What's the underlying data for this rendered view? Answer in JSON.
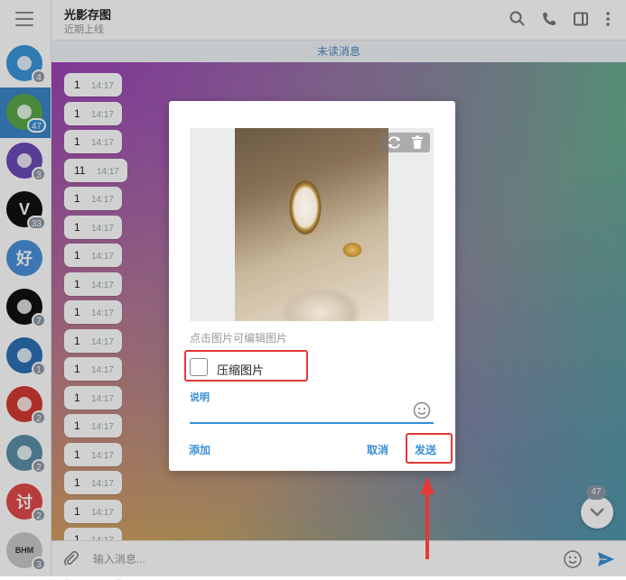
{
  "sidebar": {
    "chats": [
      {
        "label": "",
        "badge": "4",
        "color": "#3a95d8",
        "icon": "paper-plane-icon"
      },
      {
        "label": "",
        "badge": "47",
        "color": "#5ba84a",
        "icon": "sprout-icon"
      },
      {
        "label": "",
        "badge": "3",
        "color": "#6c4bb8",
        "icon": "rocket-icon"
      },
      {
        "label": "V",
        "badge": "33",
        "color": "#111111",
        "icon": "v-logo-icon"
      },
      {
        "label": "好",
        "badge": "",
        "color": "#4a90d9",
        "icon": ""
      },
      {
        "label": "",
        "badge": "7",
        "color": "#111111",
        "icon": "apple-icon"
      },
      {
        "label": "",
        "badge": "1",
        "color": "#2d6fb4",
        "icon": "head-icon"
      },
      {
        "label": "",
        "badge": "2",
        "color": "#d33a32",
        "icon": "globe-icon"
      },
      {
        "label": "",
        "badge": "2",
        "color": "#5b8fa6",
        "icon": "lock-icon"
      },
      {
        "label": "讨",
        "badge": "2",
        "color": "#e04a48",
        "icon": ""
      },
      {
        "label": "BHM",
        "badge": "3",
        "color": "#c9c9c9",
        "icon": ""
      }
    ]
  },
  "header": {
    "title": "光影存图",
    "status": "近期上线"
  },
  "unread_bar": "未读消息",
  "messages": [
    {
      "text": "1",
      "time": "14:17"
    },
    {
      "text": "1",
      "time": "14:17"
    },
    {
      "text": "1",
      "time": "14:17"
    },
    {
      "text": "11",
      "time": "14:17"
    },
    {
      "text": "1",
      "time": "14:17"
    },
    {
      "text": "1",
      "time": "14:17"
    },
    {
      "text": "1",
      "time": "14:17"
    },
    {
      "text": "1",
      "time": "14:17"
    },
    {
      "text": "1",
      "time": "14:17"
    },
    {
      "text": "1",
      "time": "14:17"
    },
    {
      "text": "1",
      "time": "14:17"
    },
    {
      "text": "1",
      "time": "14:17"
    },
    {
      "text": "1",
      "time": "14:17"
    },
    {
      "text": "1",
      "time": "14:17"
    },
    {
      "text": "1",
      "time": "14:17"
    },
    {
      "text": "1",
      "time": "14:17"
    },
    {
      "text": "1",
      "time": "14:17"
    },
    {
      "text": "1",
      "time": "14:17"
    }
  ],
  "scroll_badge": "47",
  "composer": {
    "placeholder": "输入消息..."
  },
  "dialog": {
    "caption_hint": "点击图片可编辑图片",
    "compress_label": "压缩图片",
    "compress_checked": false,
    "caption_label": "说明",
    "add_label": "添加",
    "cancel_label": "取消",
    "send_label": "发送"
  },
  "colors": {
    "accent": "#3a8fd6",
    "highlight": "#e53935"
  }
}
